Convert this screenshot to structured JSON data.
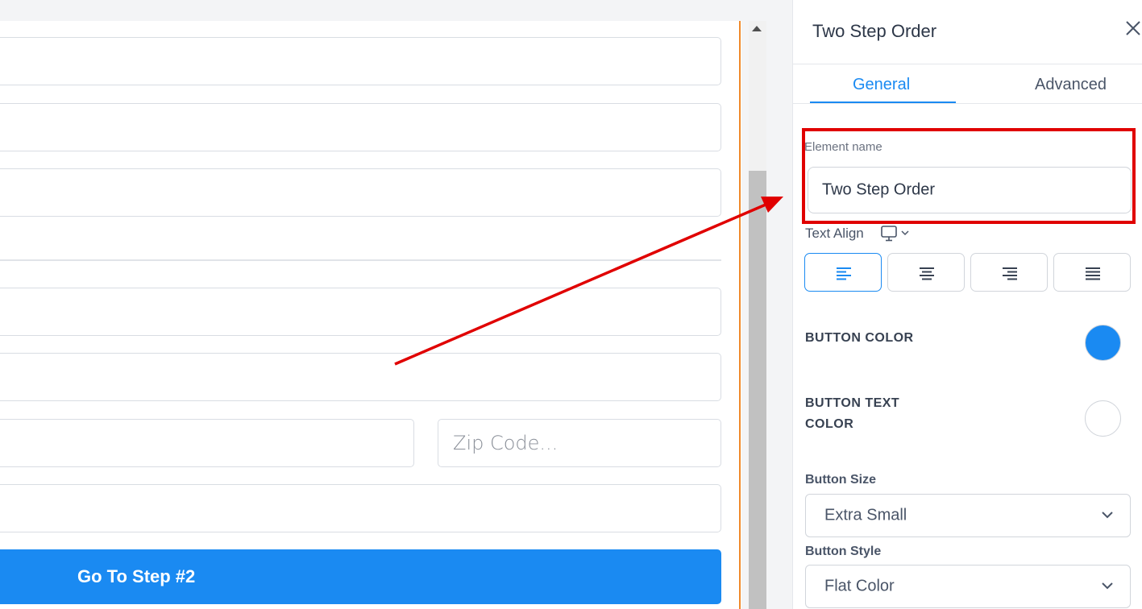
{
  "canvas": {
    "zip_placeholder": "Zip Code...",
    "step_button": "Go To Step #2"
  },
  "panel": {
    "title": "Two Step Order",
    "tabs": [
      {
        "label": "General",
        "active": true
      },
      {
        "label": "Advanced",
        "active": false
      }
    ],
    "element_name_label": "Element name",
    "element_name_value": "Two Step Order",
    "text_align_label": "Text Align",
    "text_align_options": [
      "left",
      "center",
      "right",
      "justify"
    ],
    "text_align_selected": "left",
    "button_color_label": "BUTTON COLOR",
    "button_color": "#1a8af2",
    "button_text_color_label_line1": "BUTTON TEXT",
    "button_text_color_label_line2": "COLOR",
    "button_text_color": "#ffffff",
    "button_size_label": "Button Size",
    "button_size_value": "Extra Small",
    "button_style_label": "Button Style",
    "button_style_value": "Flat Color"
  },
  "icons": {
    "close": "close-icon",
    "monitor": "monitor-icon",
    "chevron": "chevron-down-icon"
  },
  "colors": {
    "accent": "#1a8af2",
    "annotation": "#e00000",
    "canvas_border": "#f0892b"
  }
}
